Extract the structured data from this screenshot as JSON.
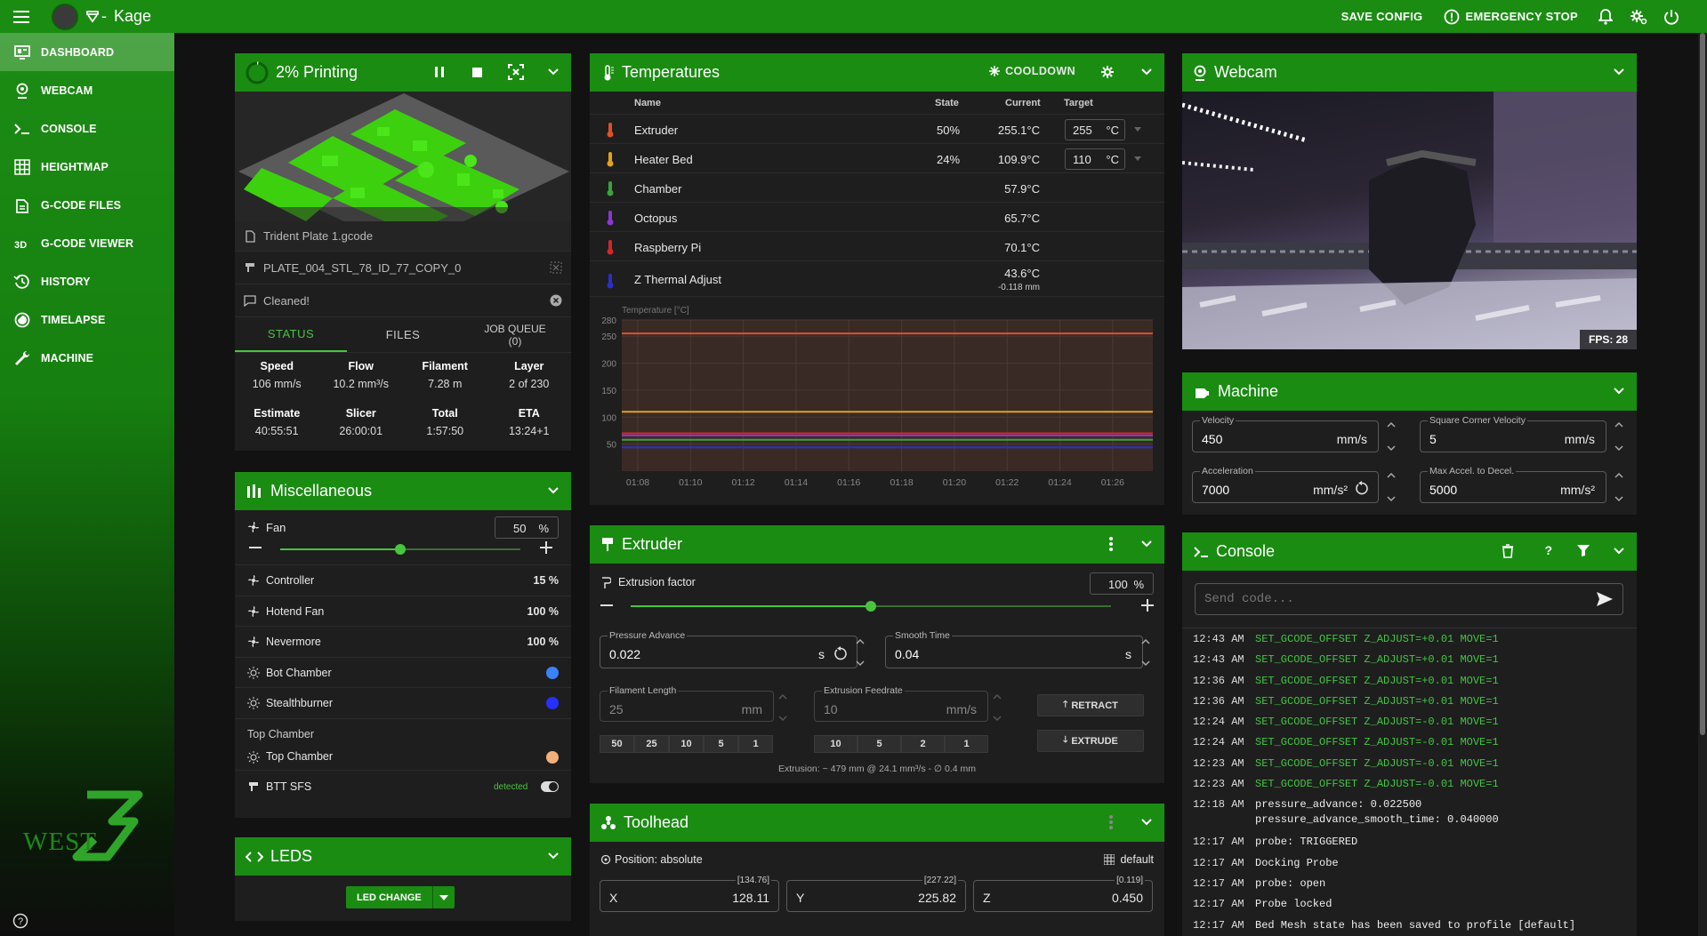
{
  "topbar": {
    "title": "Kage",
    "save_config": "SAVE CONFIG",
    "emergency_stop": "EMERGENCY STOP"
  },
  "sidebar": {
    "items": [
      {
        "label": "DASHBOARD",
        "icon": "dashboard-icon"
      },
      {
        "label": "WEBCAM",
        "icon": "webcam-icon"
      },
      {
        "label": "CONSOLE",
        "icon": "console-icon"
      },
      {
        "label": "HEIGHTMAP",
        "icon": "grid-icon"
      },
      {
        "label": "G-CODE FILES",
        "icon": "files-icon"
      },
      {
        "label": "G-CODE VIEWER",
        "icon": "3d-icon"
      },
      {
        "label": "HISTORY",
        "icon": "history-icon"
      },
      {
        "label": "TIMELAPSE",
        "icon": "timelapse-icon"
      },
      {
        "label": "MACHINE",
        "icon": "wrench-icon"
      }
    ],
    "brand": "WEST"
  },
  "status": {
    "title": "2% Printing",
    "progress": 0.02,
    "filename": "Trident Plate 1.gcode",
    "object": "PLATE_004_STL_78_ID_77_COPY_0",
    "message": "Cleaned!",
    "tabs": [
      "STATUS",
      "FILES",
      "JOB QUEUE\n(0)"
    ],
    "stats1": [
      {
        "label": "Speed",
        "value": "106 mm/s"
      },
      {
        "label": "Flow",
        "value": "10.2 mm³/s"
      },
      {
        "label": "Filament",
        "value": "7.28 m"
      },
      {
        "label": "Layer",
        "value": "2 of 230"
      }
    ],
    "stats2": [
      {
        "label": "Estimate",
        "value": "40:55:51"
      },
      {
        "label": "Slicer",
        "value": "26:00:01"
      },
      {
        "label": "Total",
        "value": "1:57:50"
      },
      {
        "label": "ETA",
        "value": "13:24+1"
      }
    ]
  },
  "misc": {
    "title": "Miscellaneous",
    "fan_label": "Fan",
    "fan_value": "50",
    "fan_unit": "%",
    "fan_level": 0.5,
    "rows": [
      {
        "label": "Controller",
        "value": "15 %"
      },
      {
        "label": "Hotend Fan",
        "value": "100 %"
      },
      {
        "label": "Nevermore",
        "value": "100 %"
      }
    ],
    "leds": [
      {
        "label": "Bot Chamber",
        "color": "#3b82f6"
      },
      {
        "label": "Stealthburner",
        "color": "#2530ff"
      }
    ],
    "top_chamber_header": "Top Chamber",
    "top_chamber_label": "Top Chamber",
    "top_chamber_color": "#f3b07a",
    "sfs_label": "BTT SFS",
    "sfs_status": "detected"
  },
  "leds": {
    "title": "LEDS",
    "button": "LED CHANGE"
  },
  "temps": {
    "title": "Temperatures",
    "cooldown": "COOLDOWN",
    "headers": {
      "name": "Name",
      "state": "State",
      "current": "Current",
      "target": "Target"
    },
    "rows": [
      {
        "name": "Extruder",
        "state": "50%",
        "current": "255.1°C",
        "target": "255",
        "unit": "°C",
        "color": "#e0502a"
      },
      {
        "name": "Heater Bed",
        "state": "24%",
        "current": "109.9°C",
        "target": "110",
        "unit": "°C",
        "color": "#e2a21b"
      },
      {
        "name": "Chamber",
        "state": "",
        "current": "57.9°C",
        "color": "#3aa33a"
      },
      {
        "name": "Octopus",
        "state": "",
        "current": "65.7°C",
        "color": "#8a38d0"
      },
      {
        "name": "Raspberry Pi",
        "state": "",
        "current": "70.1°C",
        "color": "#d02828"
      },
      {
        "name": "Z Thermal Adjust",
        "state": "",
        "current": "43.6°C",
        "sub": "-0.118 mm",
        "color": "#2a30c8"
      }
    ]
  },
  "chart_data": {
    "type": "line",
    "ylabel": "Temperature [°C]",
    "ylim": [
      0,
      280
    ],
    "yticks": [
      50,
      100,
      150,
      200,
      250,
      280
    ],
    "xticks": [
      "01:08",
      "01:10",
      "01:12",
      "01:14",
      "01:16",
      "01:18",
      "01:20",
      "01:22",
      "01:24",
      "01:26"
    ],
    "series": [
      {
        "name": "Extruder",
        "color": "#e0502a",
        "values": [
          255,
          255,
          255,
          255,
          255,
          255,
          255,
          255,
          255,
          255
        ]
      },
      {
        "name": "Heater Bed",
        "color": "#e2a21b",
        "values": [
          110,
          110,
          110,
          110,
          110,
          110,
          110,
          110,
          110,
          110
        ]
      },
      {
        "name": "Raspberry Pi",
        "color": "#d02828",
        "values": [
          70,
          70,
          70,
          70,
          70,
          70,
          70,
          70,
          70,
          70
        ]
      },
      {
        "name": "Octopus",
        "color": "#8a38d0",
        "values": [
          66,
          66,
          66,
          66,
          66,
          66,
          66,
          66,
          66,
          66
        ]
      },
      {
        "name": "Chamber",
        "color": "#3aa33a",
        "values": [
          58,
          58,
          58,
          58,
          58,
          58,
          58,
          58,
          58,
          58
        ]
      },
      {
        "name": "Z Thermal Adjust",
        "color": "#2a30c8",
        "values": [
          44,
          44,
          44,
          44,
          44,
          44,
          44,
          44,
          44,
          44
        ]
      }
    ]
  },
  "extruder": {
    "title": "Extruder",
    "factor_label": "Extrusion factor",
    "factor_value": "100",
    "factor_unit": "%",
    "factor_level": 0.5,
    "pa_label": "Pressure Advance",
    "pa_value": "0.022",
    "pa_unit": "s",
    "st_label": "Smooth Time",
    "st_value": "0.04",
    "st_unit": "s",
    "fl_label": "Filament Length",
    "fl_value": "25",
    "fl_unit": "mm",
    "ef_label": "Extrusion Feedrate",
    "ef_value": "10",
    "ef_unit": "mm/s",
    "len_buttons": [
      "50",
      "25",
      "10",
      "5",
      "1"
    ],
    "feed_buttons": [
      "10",
      "5",
      "2",
      "1"
    ],
    "retract": "RETRACT",
    "extrude": "EXTRUDE",
    "info": "Extrusion: ~ 479 mm @ 24.1 mm³/s - ∅ 0.4 mm"
  },
  "toolhead": {
    "title": "Toolhead",
    "position": "Position: absolute",
    "profile": "default",
    "axes": [
      {
        "label": "X",
        "value": "128.11",
        "max": "[134.76]"
      },
      {
        "label": "Y",
        "value": "225.82",
        "max": "[227.22]"
      },
      {
        "label": "Z",
        "value": "0.450",
        "max": "[0.119]"
      }
    ]
  },
  "webcam": {
    "title": "Webcam",
    "fps": "FPS: 28"
  },
  "machine": {
    "title": "Machine",
    "velocity_label": "Velocity",
    "velocity_value": "450",
    "velocity_unit": "mm/s",
    "scv_label": "Square Corner Velocity",
    "scv_value": "5",
    "scv_unit": "mm/s",
    "accel_label": "Acceleration",
    "accel_value": "7000",
    "accel_unit": "mm/s²",
    "decel_label": "Max Accel. to Decel.",
    "decel_value": "5000",
    "decel_unit": "mm/s²"
  },
  "console": {
    "title": "Console",
    "placeholder": "Send code...",
    "lines": [
      {
        "time": "12:43 AM",
        "msg": "SET_GCODE_OFFSET Z_ADJUST=+0.01 MOVE=1",
        "cmd": true
      },
      {
        "time": "12:43 AM",
        "msg": "SET_GCODE_OFFSET Z_ADJUST=+0.01 MOVE=1",
        "cmd": true
      },
      {
        "time": "12:36 AM",
        "msg": "SET_GCODE_OFFSET Z_ADJUST=+0.01 MOVE=1",
        "cmd": true
      },
      {
        "time": "12:36 AM",
        "msg": "SET_GCODE_OFFSET Z_ADJUST=+0.01 MOVE=1",
        "cmd": true
      },
      {
        "time": "12:24 AM",
        "msg": "SET_GCODE_OFFSET Z_ADJUST=-0.01 MOVE=1",
        "cmd": true
      },
      {
        "time": "12:24 AM",
        "msg": "SET_GCODE_OFFSET Z_ADJUST=-0.01 MOVE=1",
        "cmd": true
      },
      {
        "time": "12:23 AM",
        "msg": "SET_GCODE_OFFSET Z_ADJUST=-0.01 MOVE=1",
        "cmd": true
      },
      {
        "time": "12:23 AM",
        "msg": "SET_GCODE_OFFSET Z_ADJUST=-0.01 MOVE=1",
        "cmd": true
      },
      {
        "time": "12:18 AM",
        "msg": "pressure_advance: 0.022500",
        "msg2": "pressure_advance_smooth_time: 0.040000",
        "cmd": false
      },
      {
        "time": "12:17 AM",
        "msg": "probe: TRIGGERED",
        "cmd": false
      },
      {
        "time": "12:17 AM",
        "msg": "Docking Probe",
        "cmd": false
      },
      {
        "time": "12:17 AM",
        "msg": "probe: open",
        "cmd": false
      },
      {
        "time": "12:17 AM",
        "msg": "Probe locked",
        "cmd": false
      },
      {
        "time": "12:17 AM",
        "msg": "Bed Mesh state has been saved to profile [default]",
        "cmd": false
      }
    ]
  }
}
